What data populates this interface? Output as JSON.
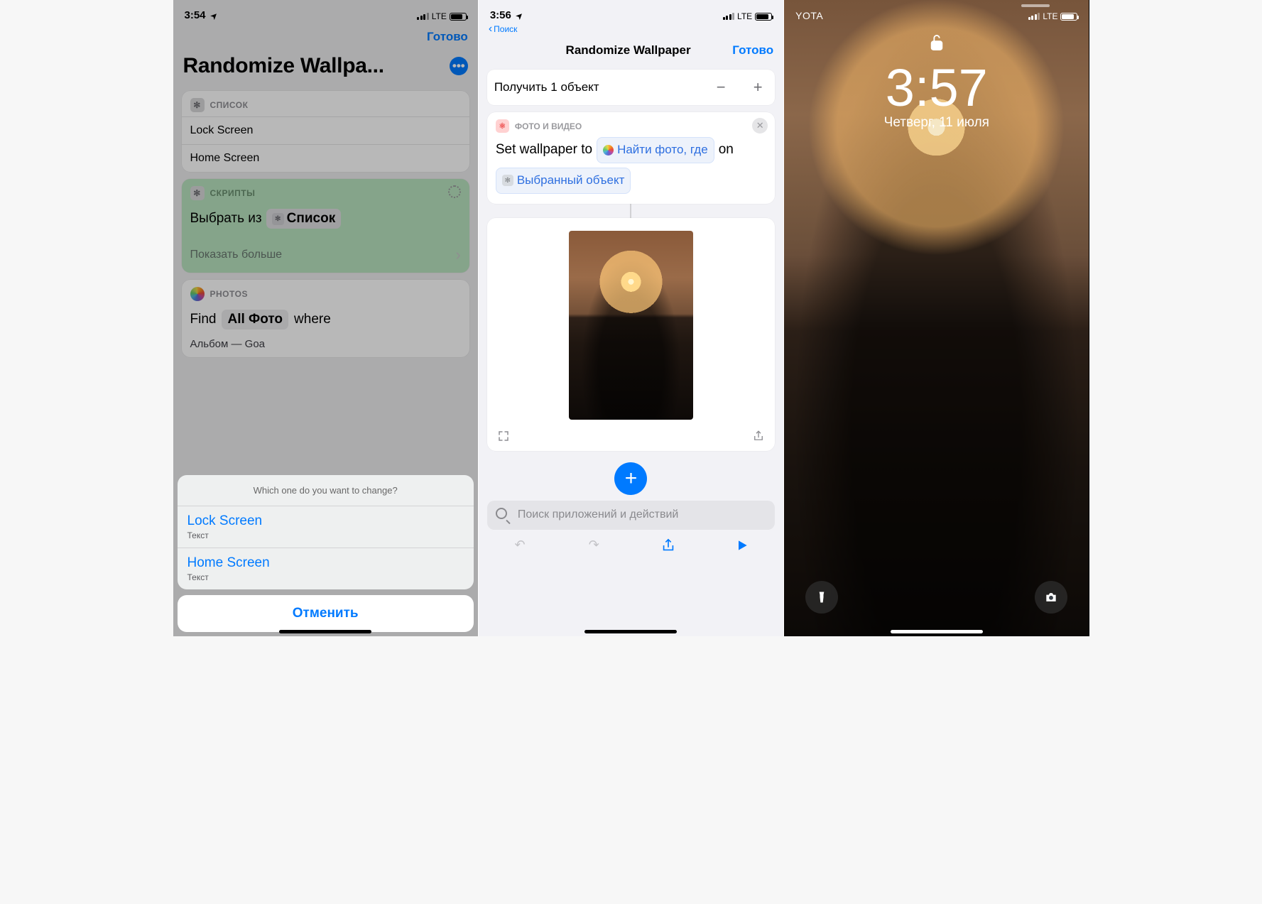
{
  "phone1": {
    "status": {
      "time": "3:54",
      "network": "LTE"
    },
    "nav": {
      "done": "Готово"
    },
    "title": "Randomize Wallpa...",
    "list_card": {
      "header": "СПИСОК",
      "items": [
        "Lock Screen",
        "Home Screen"
      ]
    },
    "scripts_card": {
      "header": "СКРИПТЫ",
      "choose": "Выбрать из",
      "token": "Список",
      "more": "Показать больше"
    },
    "photos_card": {
      "header": "PHOTOS",
      "find": "Find",
      "all": "All Фото",
      "where": "where",
      "album_line": "Альбом  —  Goa"
    },
    "sheet": {
      "prompt": "Which one do you want to change?",
      "items": [
        {
          "label": "Lock Screen",
          "sub": "Текст"
        },
        {
          "label": "Home Screen",
          "sub": "Текст"
        }
      ],
      "cancel": "Отменить"
    }
  },
  "phone2": {
    "status": {
      "time": "3:56",
      "network": "LTE"
    },
    "back": "Поиск",
    "title": "Randomize Wallpaper",
    "done": "Готово",
    "get_row": "Получить 1 объект",
    "action": {
      "header": "ФОТО И ВИДЕО",
      "line": "Set wallpaper to",
      "token1": "Найти фото, где",
      "on": "on",
      "token2": "Выбранный объект"
    },
    "search_placeholder": "Поиск приложений и действий"
  },
  "phone3": {
    "carrier": "YOTA",
    "network": "LTE",
    "time": "3:57",
    "date": "Четверг, 11 июля"
  }
}
